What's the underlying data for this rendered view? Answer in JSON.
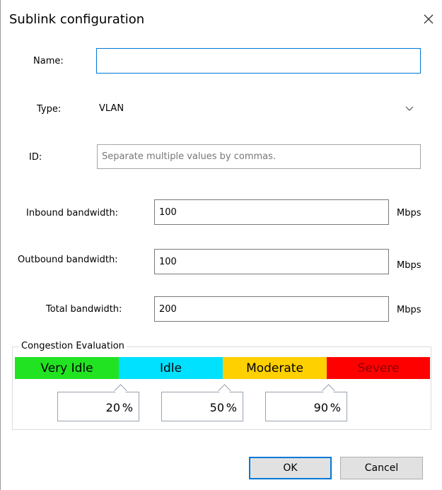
{
  "dialog": {
    "title": "Sublink configuration"
  },
  "form": {
    "name_label": "Name:",
    "name_value": "",
    "type_label": "Type:",
    "type_value": "VLAN",
    "id_label": "ID:",
    "id_placeholder": "Separate multiple values by commas.",
    "inbound_label": "Inbound bandwidth:",
    "inbound_value": "100",
    "outbound_label": "Outbound bandwidth:",
    "outbound_value": "100",
    "total_label": "Total bandwidth:",
    "total_value": "200",
    "unit": "Mbps"
  },
  "congestion": {
    "title": "Congestion Evaluation",
    "levels": [
      {
        "label": "Very Idle",
        "color": "#22e322"
      },
      {
        "label": "Idle",
        "color": "#00e1ff"
      },
      {
        "label": "Moderate",
        "color": "#ffd000"
      },
      {
        "label": "Severe",
        "color": "#ff0000"
      }
    ],
    "thresholds": [
      {
        "value": "20",
        "unit": "%"
      },
      {
        "value": "50",
        "unit": "%"
      },
      {
        "value": "90",
        "unit": "%"
      }
    ]
  },
  "buttons": {
    "ok": "OK",
    "cancel": "Cancel"
  },
  "icons": {
    "close": "close-icon",
    "dropdown": "chevron-down-icon"
  }
}
